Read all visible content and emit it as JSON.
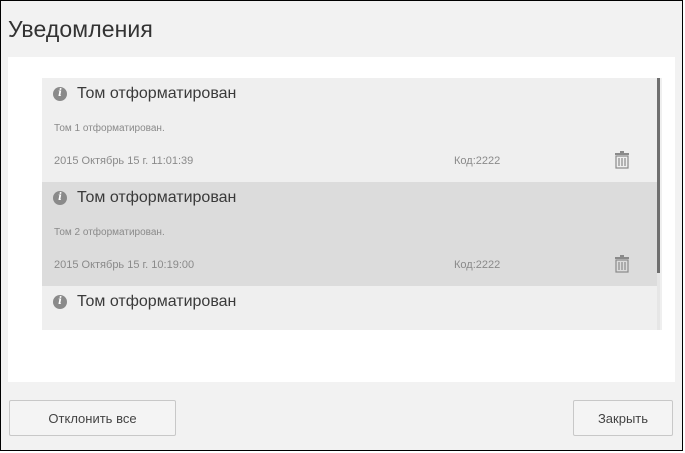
{
  "dialog": {
    "title": "Уведомления",
    "buttons": {
      "dismiss_all": "Отклонить все",
      "close": "Закрыть"
    }
  },
  "notifications": [
    {
      "title": "Том отформатирован",
      "message": "Том 1 отформатирован.",
      "date": "2015 Октябрь 15 г. 11:01:39",
      "code": "Код:2222",
      "icon": "info-icon"
    },
    {
      "title": "Том отформатирован",
      "message": "Том 2 отформатирован.",
      "date": "2015 Октябрь 15 г. 10:19:00",
      "code": "Код:2222",
      "icon": "info-icon"
    },
    {
      "title": "Том отформатирован",
      "icon": "info-icon"
    }
  ],
  "colors": {
    "dialog_bg": "#f2f2f2",
    "list_bg": "#efefef",
    "selected_bg": "#dcdcdc",
    "scroll_thumb": "#6f6f6f"
  }
}
